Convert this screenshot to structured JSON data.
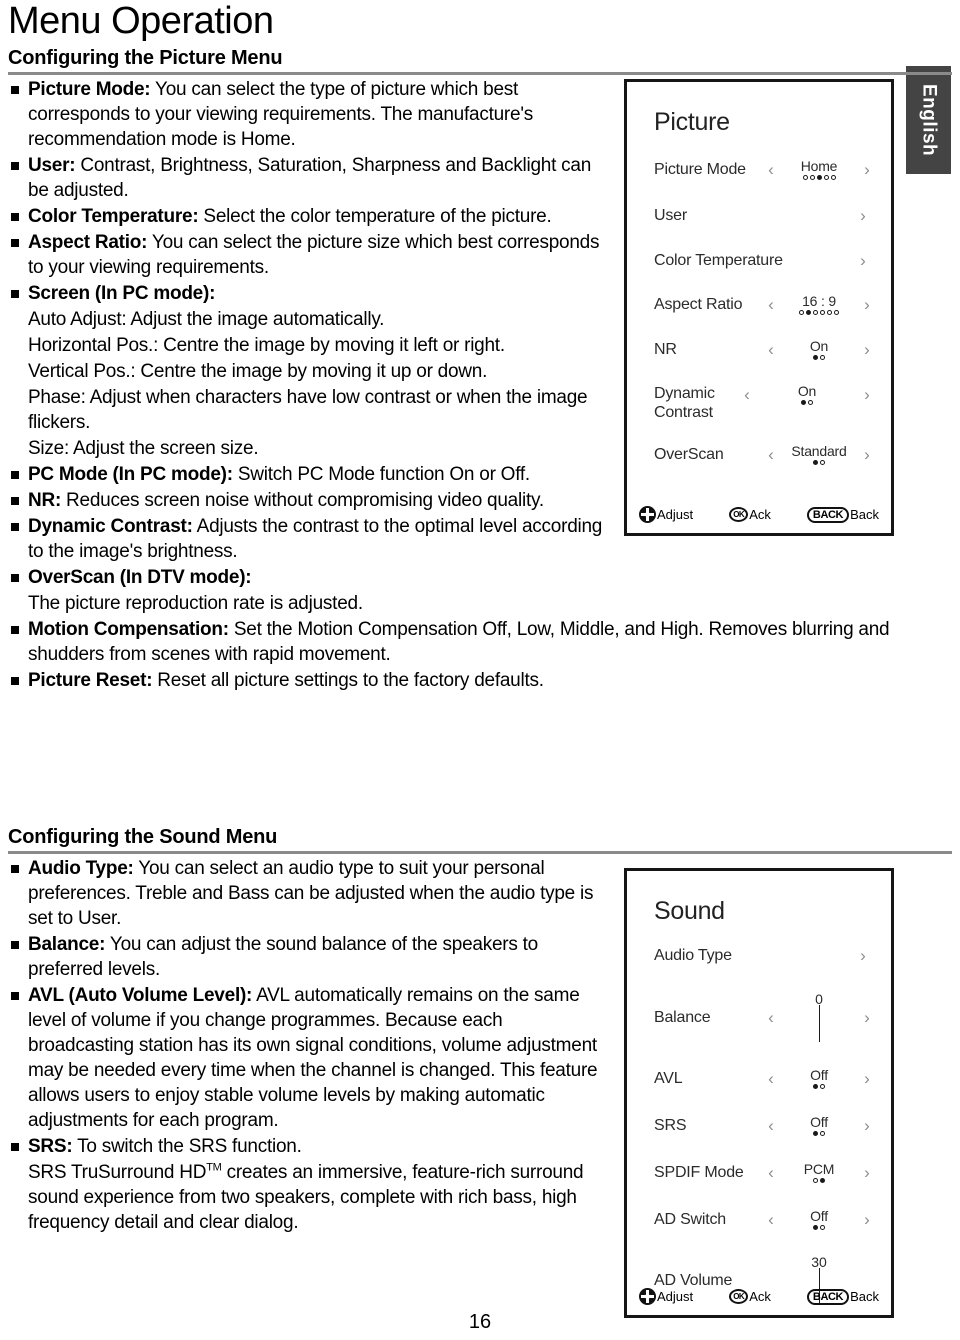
{
  "page": {
    "title": "Menu Operation",
    "number": "16",
    "language_tab": "English"
  },
  "picture_section": {
    "heading": "Configuring the Picture Menu",
    "items": [
      {
        "term": "Picture Mode:",
        "text": " You can select the type of picture which best corresponds to your viewing requirements. The manufacture's recommendation mode is Home."
      },
      {
        "term": "User:",
        "text": " Contrast, Brightness, Saturation, Sharpness and Backlight can be adjusted."
      },
      {
        "term": "Color Temperature:",
        "text": " Select the color temperature of the picture."
      },
      {
        "term": "Aspect Ratio:",
        "text": " You can select the picture size which best corresponds to your viewing requirements."
      },
      {
        "term": "Screen (In PC mode):",
        "text": ""
      },
      {
        "term": "",
        "text": "Auto Adjust: Adjust the image automatically."
      },
      {
        "term": "",
        "text": "Horizontal Pos.: Centre the image by moving it left or right."
      },
      {
        "term": "",
        "text": "Vertical Pos.: Centre the image by moving it up or down."
      },
      {
        "term": "",
        "text": "Phase: Adjust when characters have low contrast or when the image flickers."
      },
      {
        "term": "",
        "text": "Size: Adjust the screen size."
      },
      {
        "term": "PC Mode (In PC mode):",
        "text": " Switch PC Mode function On or Off."
      },
      {
        "term": "NR:",
        "text": " Reduces screen noise without compromising video quality."
      },
      {
        "term": "Dynamic Contrast:",
        "text": " Adjusts the contrast to the optimal level according to the image's brightness."
      },
      {
        "term": "OverScan (In DTV mode):",
        "text": ""
      },
      {
        "term": "",
        "text": "The picture reproduction rate is adjusted."
      },
      {
        "term": "Motion Compensation:",
        "text": " Set the Motion Compensation Off, Low, Middle, and High. Removes blurring and shudders from scenes with rapid movement."
      },
      {
        "term": "Picture Reset:",
        "text": " Reset all picture settings to the factory defaults."
      }
    ]
  },
  "sound_section": {
    "heading": "Configuring the Sound Menu",
    "items": [
      {
        "term": "Audio Type:",
        "text": " You can select an audio type to suit your personal preferences. Treble and Bass can be adjusted when the audio type is set to User."
      },
      {
        "term": "Balance:",
        "text": " You can adjust the sound balance of the speakers to preferred levels."
      },
      {
        "term": "AVL (Auto Volume Level):",
        "text": " AVL automatically remains on the same level of volume if you change programmes. Because each broadcasting station has its own signal conditions, volume adjustment may be needed every time when the channel is changed. This feature allows users to enjoy stable volume levels by making automatic adjustments for each program."
      },
      {
        "term": "SRS:",
        "text": " To switch the SRS function."
      },
      {
        "term": "",
        "text": "SRS TruSurround HD",
        "sup": "TM",
        "text2": " creates an immersive, feature-rich surround sound experience from two speakers, complete with rich bass, high frequency detail and clear dialog."
      }
    ]
  },
  "osd_picture": {
    "title": "Picture",
    "rows": [
      {
        "label": "Picture Mode",
        "type": "dots",
        "value": "Home",
        "dots_total": 5,
        "dots_active": 3,
        "arrows": true
      },
      {
        "label": "User",
        "type": "enter",
        "value": "",
        "arrows": false
      },
      {
        "label": "Color Temperature",
        "type": "enter",
        "value": "",
        "arrows": false
      },
      {
        "label": "Aspect Ratio",
        "type": "dots",
        "value": "16 : 9",
        "dots_total": 6,
        "dots_active": 2,
        "arrows": true
      },
      {
        "label": "NR",
        "type": "dots",
        "value": "On",
        "dots_total": 2,
        "dots_active": 1,
        "arrows": true
      },
      {
        "label": "Dynamic Contrast",
        "type": "dots",
        "value": "On",
        "dots_total": 2,
        "dots_active": 1,
        "arrows": true
      },
      {
        "label": "OverScan",
        "type": "dots",
        "value": "Standard",
        "dots_total": 2,
        "dots_active": 1,
        "arrows": true
      }
    ],
    "footer": {
      "adjust_label": "Adjust",
      "ok_key": "OK",
      "ok_label": "Ack",
      "back_key": "BACK",
      "back_label": "Back"
    }
  },
  "osd_sound": {
    "title": "Sound",
    "rows": [
      {
        "label": "Audio Type",
        "type": "enter",
        "value": "",
        "arrows": false
      },
      {
        "label": "Balance",
        "type": "slider",
        "value": "0",
        "fill_percent": 50,
        "arrows": true
      },
      {
        "label": "AVL",
        "type": "dots",
        "value": "Off",
        "dots_total": 2,
        "dots_active": 1,
        "arrows": true
      },
      {
        "label": "SRS",
        "type": "dots",
        "value": "Off",
        "dots_total": 2,
        "dots_active": 1,
        "arrows": true
      },
      {
        "label": "SPDIF Mode",
        "type": "dots",
        "value": "PCM",
        "dots_total": 2,
        "dots_active": 2,
        "arrows": true
      },
      {
        "label": "AD Switch",
        "type": "dots",
        "value": "Off",
        "dots_total": 2,
        "dots_active": 1,
        "arrows": true
      },
      {
        "label": "AD Volume",
        "type": "slider",
        "value": "30",
        "fill_percent": 45,
        "arrows": false
      }
    ],
    "footer": {
      "adjust_label": "Adjust",
      "ok_key": "OK",
      "ok_label": "Ack",
      "back_key": "BACK",
      "back_label": "Back"
    }
  },
  "icons": {
    "left_chevron": "‹",
    "right_chevron": "›",
    "dpad": "dpad-icon"
  }
}
